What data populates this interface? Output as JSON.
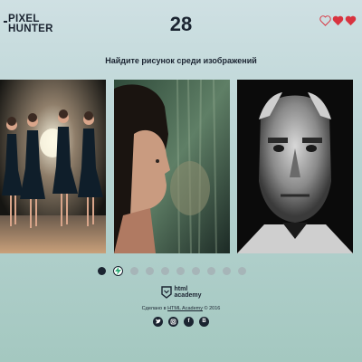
{
  "header": {
    "logo_line1": "PIXEL",
    "logo_line2": "HUNTER",
    "timer": "28",
    "lives": {
      "total": 3,
      "filled": 2
    }
  },
  "game": {
    "task": "Найдите рисунок среди изображений",
    "options": [
      {
        "label": "option-1",
        "picture": "dancers-photo"
      },
      {
        "label": "option-2",
        "picture": "girl-reflection-painting"
      },
      {
        "label": "option-3",
        "picture": "old-man-portrait-photo"
      }
    ]
  },
  "stats": {
    "results": [
      "wrong",
      "fast",
      "unknown",
      "unknown",
      "unknown",
      "unknown",
      "unknown",
      "unknown",
      "unknown",
      "unknown"
    ]
  },
  "footer": {
    "academy_line1": "html",
    "academy_line2": "academy",
    "made_prefix": "Сделано в ",
    "made_link": "HTML Academy",
    "made_suffix": " © 2016",
    "socials": [
      "twitter-icon",
      "instagram-icon",
      "facebook-icon",
      "vk-icon"
    ]
  },
  "colors": {
    "text": "#1b2431",
    "heart": "#d8333f",
    "dot_unknown": "#a6b5b8"
  }
}
